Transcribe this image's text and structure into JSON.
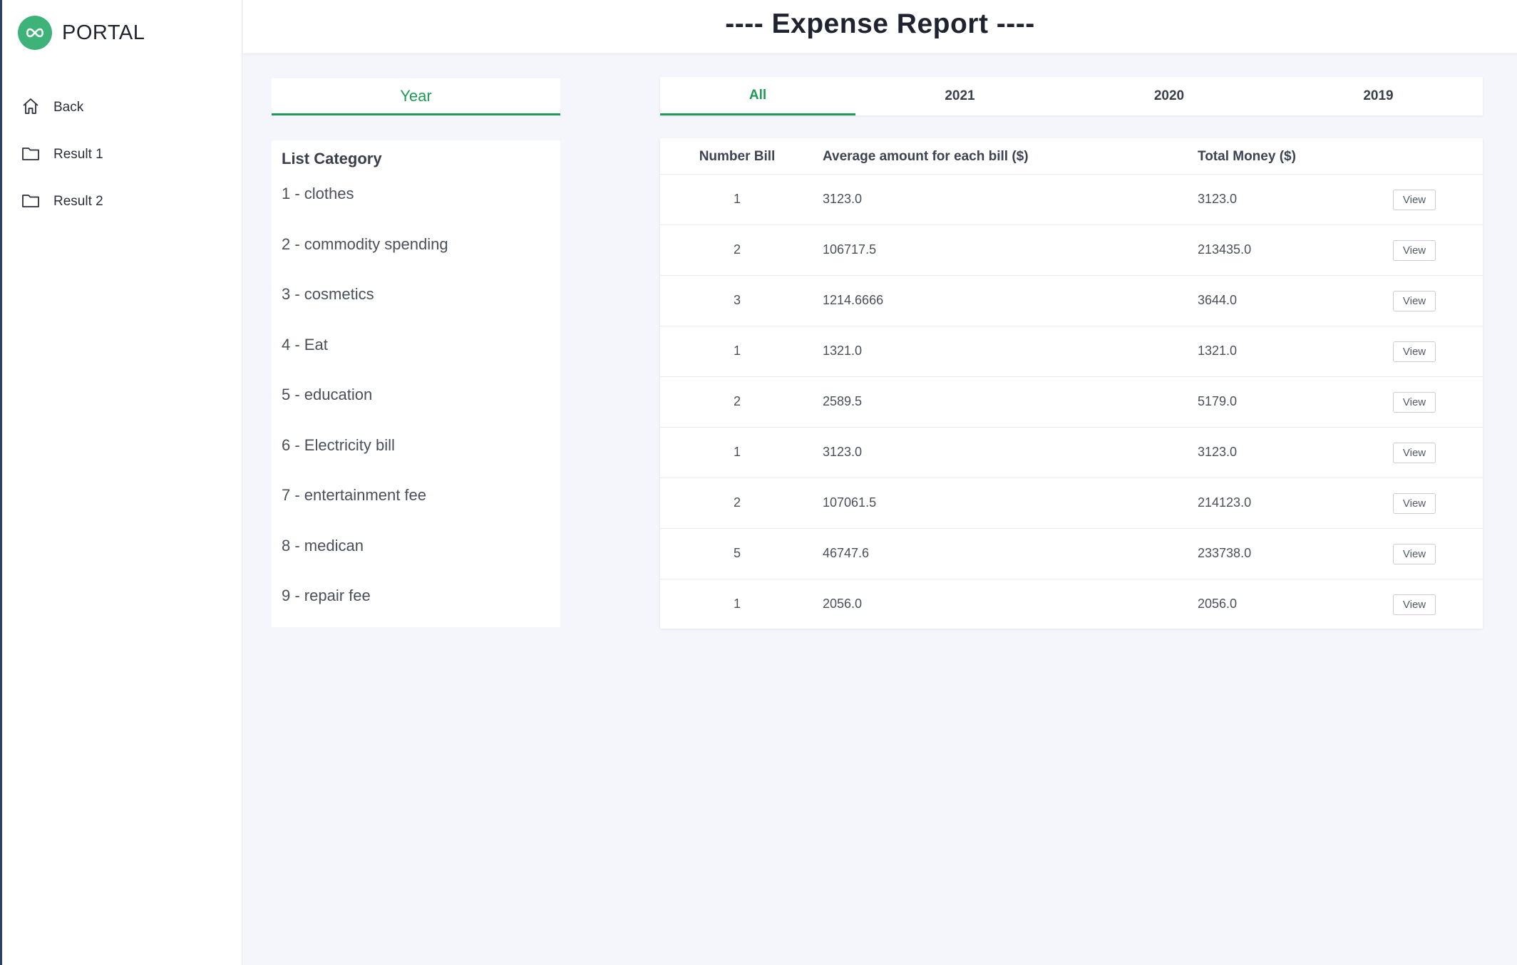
{
  "app": {
    "logo_text": "PORTAL",
    "brand_color": "#3db37a",
    "accent_color": "#1f9a55"
  },
  "sidebar": {
    "items": [
      {
        "label": "Back",
        "icon": "home-icon"
      },
      {
        "label": "Result 1",
        "icon": "folder-icon"
      },
      {
        "label": "Result 2",
        "icon": "folder-icon"
      }
    ]
  },
  "header": {
    "title": "---- Expense Report ----"
  },
  "filter": {
    "year_label": "Year"
  },
  "categories": {
    "title": "List Category",
    "items": [
      "1 - clothes",
      "2 - commodity spending",
      "3 - cosmetics",
      "4 - Eat",
      "5 - education",
      "6 - Electricity bill",
      "7 - entertainment fee",
      "8 - medican",
      "9 - repair fee"
    ]
  },
  "tabs": [
    {
      "label": "All",
      "active": true
    },
    {
      "label": "2021",
      "active": false
    },
    {
      "label": "2020",
      "active": false
    },
    {
      "label": "2019",
      "active": false
    }
  ],
  "table": {
    "headers": {
      "number_bill": "Number Bill",
      "average": "Average amount for each bill ($)",
      "total": "Total Money ($)"
    },
    "view_label": "View",
    "rows": [
      {
        "number": "1",
        "average": "3123.0",
        "total": "3123.0"
      },
      {
        "number": "2",
        "average": "106717.5",
        "total": "213435.0"
      },
      {
        "number": "3",
        "average": "1214.6666",
        "total": "3644.0"
      },
      {
        "number": "1",
        "average": "1321.0",
        "total": "1321.0"
      },
      {
        "number": "2",
        "average": "2589.5",
        "total": "5179.0"
      },
      {
        "number": "1",
        "average": "3123.0",
        "total": "3123.0"
      },
      {
        "number": "2",
        "average": "107061.5",
        "total": "214123.0"
      },
      {
        "number": "5",
        "average": "46747.6",
        "total": "233738.0"
      },
      {
        "number": "1",
        "average": "2056.0",
        "total": "2056.0"
      }
    ]
  }
}
